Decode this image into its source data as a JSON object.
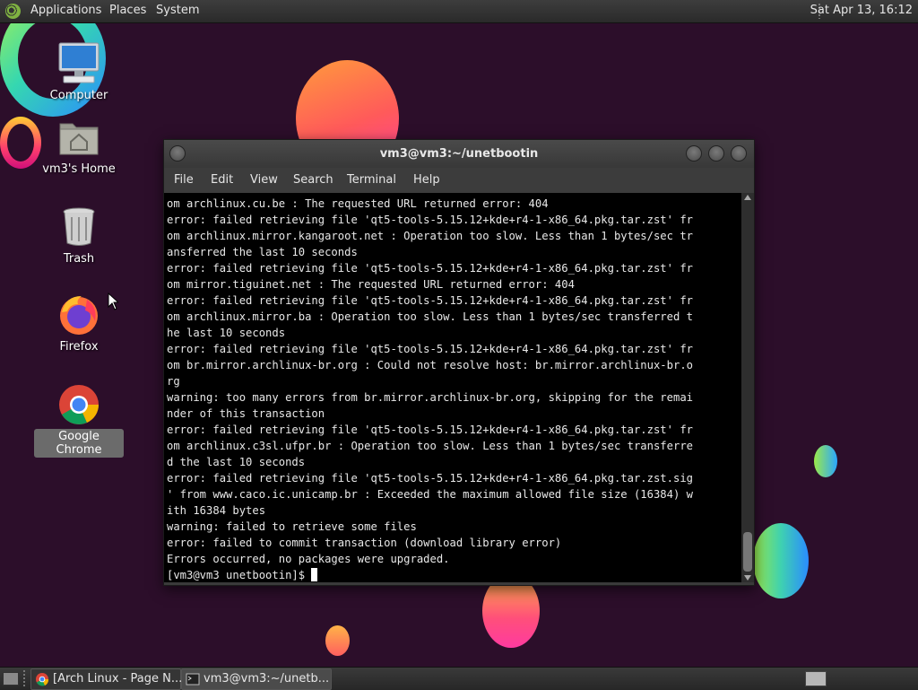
{
  "top_panel": {
    "menus": [
      "Applications",
      "Places",
      "System"
    ],
    "clock": "Sat Apr 13, 16:12"
  },
  "desktop_icons": [
    {
      "label": "Computer",
      "icon": "computer-icon"
    },
    {
      "label": "vm3's Home",
      "icon": "home-folder-icon"
    },
    {
      "label": "Trash",
      "icon": "trash-icon"
    },
    {
      "label": "Firefox",
      "icon": "firefox-icon"
    },
    {
      "label": "Google Chrome",
      "icon": "chrome-icon",
      "selected": true
    }
  ],
  "window": {
    "title": "vm3@vm3:~/unetbootin",
    "menu": [
      "File",
      "Edit",
      "View",
      "Search",
      "Terminal",
      "Help"
    ],
    "terminal_lines": [
      "om archlinux.cu.be : The requested URL returned error: 404",
      "error: failed retrieving file 'qt5-tools-5.15.12+kde+r4-1-x86_64.pkg.tar.zst' fr",
      "om archlinux.mirror.kangaroot.net : Operation too slow. Less than 1 bytes/sec tr",
      "ansferred the last 10 seconds",
      "error: failed retrieving file 'qt5-tools-5.15.12+kde+r4-1-x86_64.pkg.tar.zst' fr",
      "om mirror.tiguinet.net : The requested URL returned error: 404",
      "error: failed retrieving file 'qt5-tools-5.15.12+kde+r4-1-x86_64.pkg.tar.zst' fr",
      "om archlinux.mirror.ba : Operation too slow. Less than 1 bytes/sec transferred t",
      "he last 10 seconds",
      "error: failed retrieving file 'qt5-tools-5.15.12+kde+r4-1-x86_64.pkg.tar.zst' fr",
      "om br.mirror.archlinux-br.org : Could not resolve host: br.mirror.archlinux-br.o",
      "rg",
      "warning: too many errors from br.mirror.archlinux-br.org, skipping for the remai",
      "nder of this transaction",
      "error: failed retrieving file 'qt5-tools-5.15.12+kde+r4-1-x86_64.pkg.tar.zst' fr",
      "om archlinux.c3sl.ufpr.br : Operation too slow. Less than 1 bytes/sec transferre",
      "d the last 10 seconds",
      "error: failed retrieving file 'qt5-tools-5.15.12+kde+r4-1-x86_64.pkg.tar.zst.sig",
      "' from www.caco.ic.unicamp.br : Exceeded the maximum allowed file size (16384) w",
      "ith 16384 bytes",
      "warning: failed to retrieve some files",
      "error: failed to commit transaction (download library error)",
      "Errors occurred, no packages were upgraded."
    ],
    "prompt": "[vm3@vm3 unetbootin]$ "
  },
  "taskbar": {
    "tasks": [
      {
        "label": "[Arch Linux - Page N...",
        "icon": "chrome-icon"
      },
      {
        "label": "vm3@vm3:~/unetb...",
        "icon": "terminal-icon",
        "active": true
      }
    ]
  }
}
